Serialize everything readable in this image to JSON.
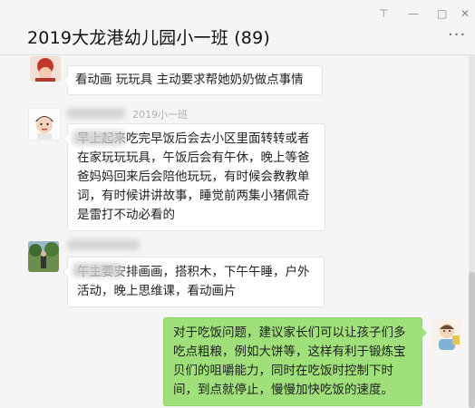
{
  "window": {
    "title": "2019大龙港幼儿园小一班 (89)",
    "controls": {
      "pin": "⊤",
      "minimize": "—",
      "maximize": "□",
      "close": "✕"
    },
    "more_label": "···"
  },
  "messages": [
    {
      "side": "left",
      "avatar": "red-haired-child-avatar",
      "text": "看动画 玩玩具 主动要求帮她奶奶做点事情"
    },
    {
      "side": "left",
      "avatar": "child-face-avatar",
      "nick": "2019小一班",
      "text": "早上起来吃完早饭后会去小区里面转转或者在家玩玩玩具，午饭后会有午休，晚上等爸爸妈妈回来后会陪他玩玩，有时候会教教单词，有时候讲讲故事，睡觉前两集小猪佩奇是雷打不动必看的"
    },
    {
      "side": "left",
      "avatar": "outdoor-photo-avatar",
      "text": "午主要安排画画，搭积木，下午午睡，户外活动，晚上思维课，看动画片"
    },
    {
      "side": "right",
      "avatar": "cartoon-teacher-avatar",
      "text": "对于吃饭问题，建议家长们可以让孩子们多吃点粗粮，例如大饼等，这样有利于锻炼宝贝们的咀嚼能力，同时在吃饭时控制下时间，到点就停止，慢慢加快吃饭的速度。"
    }
  ]
}
